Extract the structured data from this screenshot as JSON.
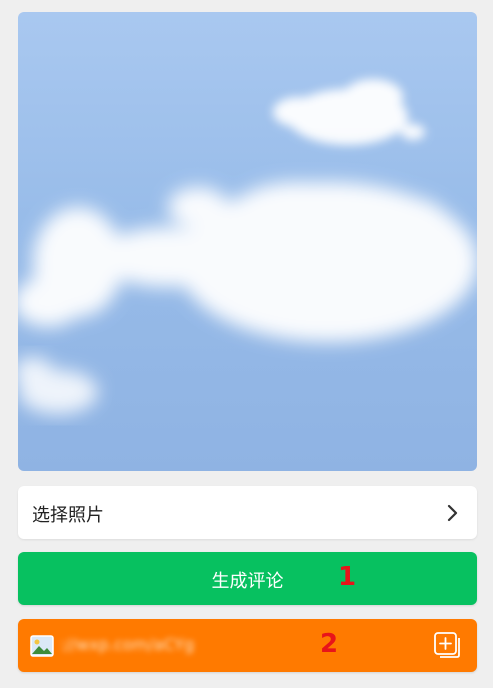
{
  "photo": {
    "icon": "sky-with-clouds-image"
  },
  "select_row": {
    "label": "选择照片",
    "icon": "chevron-right-icon"
  },
  "generate_button": {
    "label": "生成评论",
    "marker": "1",
    "color": "#07c160"
  },
  "link_bar": {
    "text": "://wxp.com/aCYg",
    "marker": "2",
    "color": "#ff7a00",
    "left_icon": "image-icon",
    "right_icon": "add-icon"
  },
  "colors": {
    "background": "#efefef",
    "marker": "#e8141a",
    "sky": "#98bce9"
  }
}
